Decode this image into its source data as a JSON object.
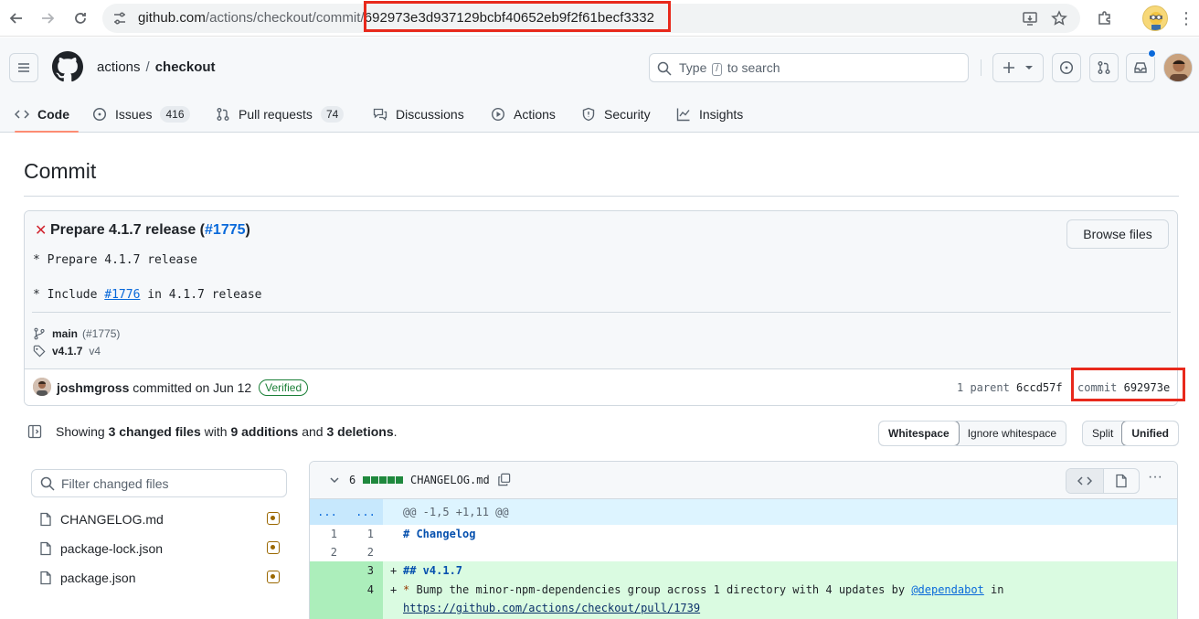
{
  "browser": {
    "url_host": "github.com",
    "url_path": "/actions/checkout/commit/",
    "url_hash": "692973e3d937129bcbf40652eb9f2f61becf3332"
  },
  "header": {
    "owner": "actions",
    "separator": "/",
    "repo": "checkout",
    "search_prefix": "Type",
    "search_key": "/",
    "search_suffix": "to search"
  },
  "tabs": [
    {
      "label": "Code"
    },
    {
      "label": "Issues",
      "count": "416"
    },
    {
      "label": "Pull requests",
      "count": "74"
    },
    {
      "label": "Discussions"
    },
    {
      "label": "Actions"
    },
    {
      "label": "Security"
    },
    {
      "label": "Insights"
    }
  ],
  "page": {
    "title": "Commit"
  },
  "commit": {
    "title_prefix": "Prepare 4.1.7 release (",
    "title_link": "#1775",
    "title_suffix": ")",
    "browse_label": "Browse files",
    "msg1": "* Prepare 4.1.7 release",
    "msg2_prefix": "* Include ",
    "msg2_link": "#1776",
    "msg2_suffix": " in 4.1.7 release",
    "branch": "main",
    "branch_pr": "(#1775)",
    "tag": "v4.1.7",
    "tag_extra": "v4",
    "author": "joshmgross",
    "committed_text": "committed on Jun 12",
    "verified": "Verified",
    "parent_label": "1 parent",
    "parent_sha": "6ccd57f",
    "commit_label": "commit",
    "commit_sha": "692973e"
  },
  "summary": {
    "showing": "Showing",
    "files": "3 changed files",
    "with": "with",
    "additions": "9 additions",
    "and": "and",
    "deletions": "3 deletions",
    "end": ".",
    "whitespace": "Whitespace",
    "ignore_whitespace": "Ignore whitespace",
    "split": "Split",
    "unified": "Unified"
  },
  "tree": {
    "filter_placeholder": "Filter changed files",
    "files": [
      "CHANGELOG.md",
      "package-lock.json",
      "package.json"
    ]
  },
  "diff": {
    "count": "6",
    "file": "CHANGELOG.md",
    "hunk_a": "...",
    "hunk_b": "...",
    "hunk_text": "@@ -1,5 +1,11 @@",
    "lines": [
      {
        "a": "1",
        "b": "1",
        "text": "# Changelog"
      },
      {
        "a": "2",
        "b": "2",
        "text": ""
      },
      {
        "a": "",
        "b": "3",
        "sign": "+",
        "text": "## v4.1.7"
      },
      {
        "a": "",
        "b": "4",
        "sign": "+",
        "star": "*",
        "text": " Bump the minor-npm-dependencies group across 1 directory with 4 updates by ",
        "mention": "@dependabot",
        "tail": " in"
      },
      {
        "url": "https://github.com/actions/checkout/pull/1739"
      }
    ]
  },
  "colors": {
    "accent": "#0969da",
    "highlight_box": "#e8291c",
    "addition": "#1f883d",
    "fail": "#d1242f"
  }
}
